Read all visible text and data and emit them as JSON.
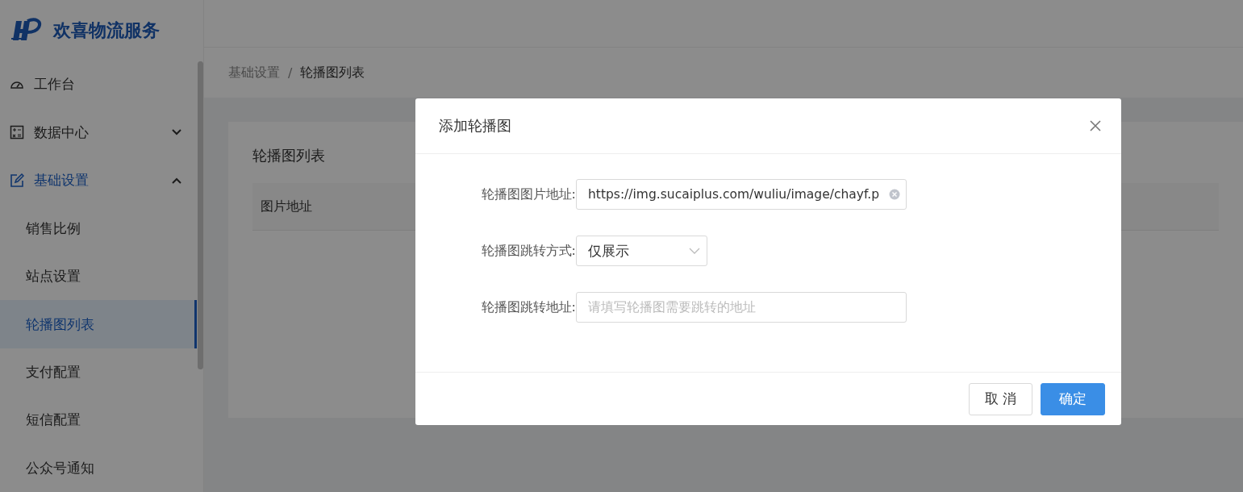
{
  "brand": {
    "name": "欢喜物流服务"
  },
  "menu": [
    {
      "label": "工作台",
      "kind": "top",
      "selected": false
    },
    {
      "label": "数据中心",
      "kind": "group",
      "expanded": false,
      "selected": false
    },
    {
      "label": "基础设置",
      "kind": "group",
      "expanded": true,
      "selected": true,
      "children": [
        {
          "label": "销售比例",
          "selected": false
        },
        {
          "label": "站点设置",
          "selected": false
        },
        {
          "label": "轮播图列表",
          "selected": true
        },
        {
          "label": "支付配置",
          "selected": false
        },
        {
          "label": "短信配置",
          "selected": false
        },
        {
          "label": "公众号通知",
          "selected": false
        }
      ]
    }
  ],
  "breadcrumb": [
    "基础设置",
    "/",
    "轮播图列表"
  ],
  "card": {
    "title": "轮播图列表",
    "table": {
      "columns": [
        "图片地址"
      ]
    }
  },
  "dialog": {
    "title": "添加轮播图",
    "fields": [
      {
        "kind": "text",
        "label": "轮播图图片地址:",
        "value": "https://img.sucaiplus.com/wuliu/image/chayf.p",
        "clearable": true
      },
      {
        "kind": "select",
        "label": "轮播图跳转方式:",
        "value": "仅展示"
      },
      {
        "kind": "text",
        "label": "轮播图跳转地址:",
        "placeholder": "请填写轮播图需要跳转的地址",
        "clearable": false
      }
    ],
    "buttons": [
      {
        "label": "取 消",
        "kind": "default"
      },
      {
        "label": "确定",
        "kind": "primary"
      }
    ]
  }
}
